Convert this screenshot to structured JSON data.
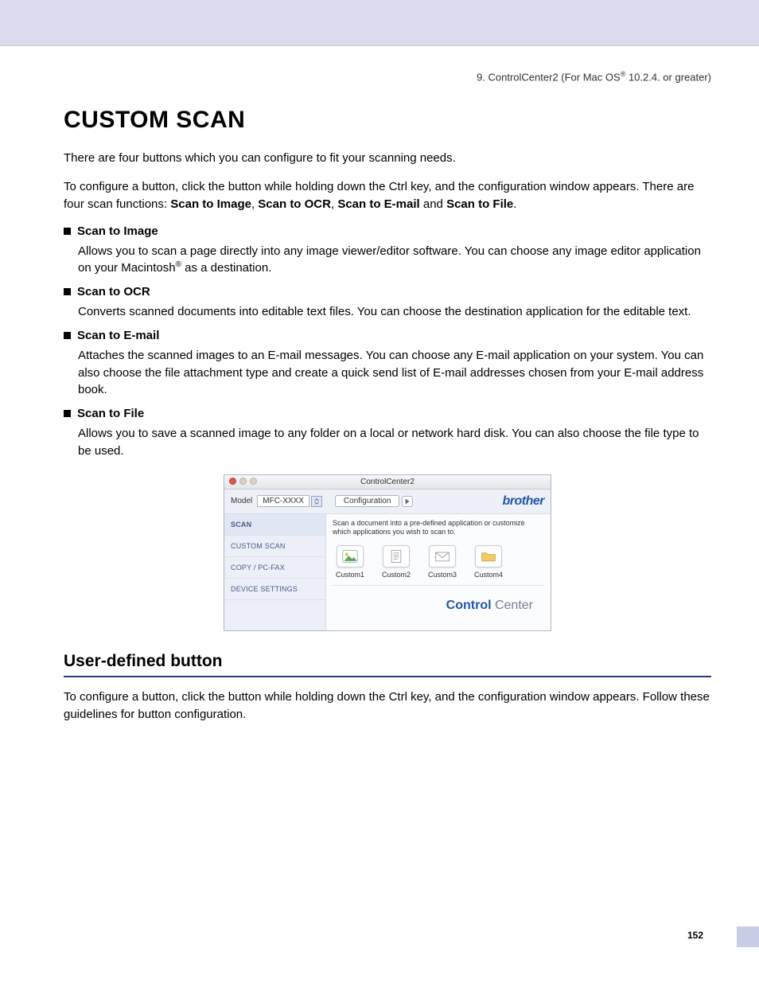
{
  "header": {
    "chapter_prefix": "9. ControlCenter2 (For Mac OS",
    "chapter_suffix": " 10.2.4. or greater)"
  },
  "title": "CUSTOM SCAN",
  "intro1": "There are four buttons which you can configure to fit your scanning needs.",
  "intro2_a": "To configure a button, click the button while holding down the Ctrl key, and the configuration window appears. There are four scan functions: ",
  "intro2_b1": "Scan to Image",
  "intro2_b2": "Scan to OCR",
  "intro2_b3": "Scan to E-mail",
  "intro2_b4": "Scan to File",
  "and": " and ",
  "sep": ", ",
  "period": ".",
  "items": [
    {
      "head": "Scan to Image",
      "body_a": "Allows you to scan a page directly into any image viewer/editor software. You can choose any image editor application on your Macintosh",
      "body_b": " as a destination."
    },
    {
      "head": "Scan to OCR",
      "body_a": "Converts scanned documents into editable text files. You can choose the destination application for the editable text.",
      "body_b": ""
    },
    {
      "head": "Scan to E-mail",
      "body_a": "Attaches the scanned images to an E-mail messages. You can choose any E-mail application on your system. You can also choose the file attachment type and create a quick send list of E-mail addresses chosen from your E-mail address book.",
      "body_b": ""
    },
    {
      "head": "Scan to File",
      "body_a": "Allows you to save a scanned image to any folder on a local or network hard disk. You can also choose the file type to be used.",
      "body_b": ""
    }
  ],
  "screenshot": {
    "title": "ControlCenter2",
    "model_label": "Model",
    "model_value": "MFC-XXXX",
    "config_label": "Configuration",
    "brand": "brother",
    "sidebar": [
      "SCAN",
      "CUSTOM SCAN",
      "COPY / PC-FAX",
      "DEVICE SETTINGS"
    ],
    "hint": "Scan a document into a pre-defined application or customize which applications you wish to scan to.",
    "buttons": [
      "Custom1",
      "Custom2",
      "Custom3",
      "Custom4"
    ],
    "logo_a": "Control",
    "logo_b": " Center"
  },
  "section2_title": "User-defined button",
  "section2_body": "To configure a button, click the button while holding down the Ctrl key, and the configuration window appears. Follow these guidelines for button configuration.",
  "page_number": "152"
}
